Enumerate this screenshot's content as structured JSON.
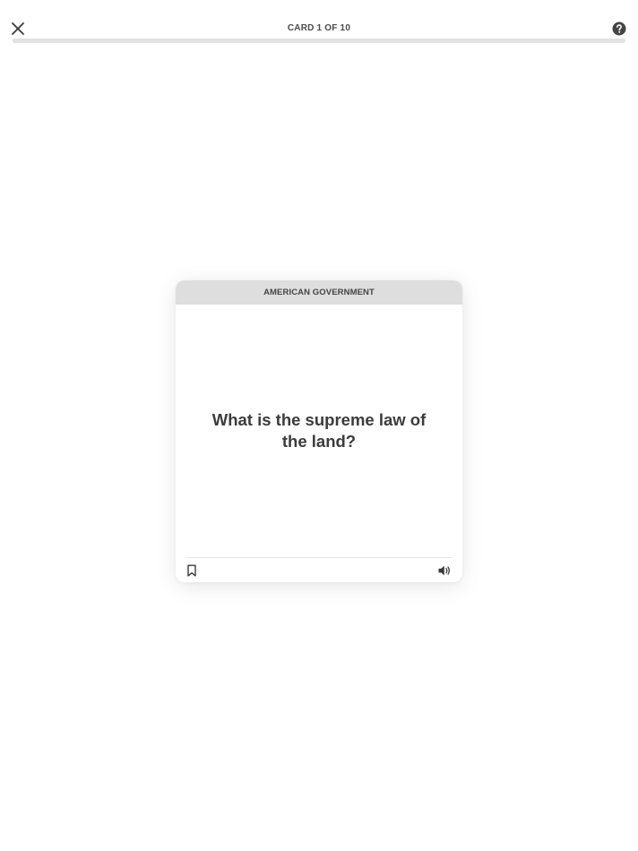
{
  "header": {
    "counter": "CARD 1 OF 10",
    "close_icon": "close-icon",
    "help_icon": "help-icon"
  },
  "progress": {
    "current": 1,
    "total": 10,
    "fraction": 0
  },
  "card": {
    "category": "AMERICAN GOVERNMENT",
    "question": "What is the supreme law of the land?",
    "bookmark_icon": "bookmark-icon",
    "audio_icon": "speaker-icon"
  },
  "colors": {
    "background": "#ffffff",
    "header_band": "#dedede",
    "progress_track": "#e2e2e2",
    "text_dark": "#3c3c3c",
    "help_icon": "#444444"
  }
}
